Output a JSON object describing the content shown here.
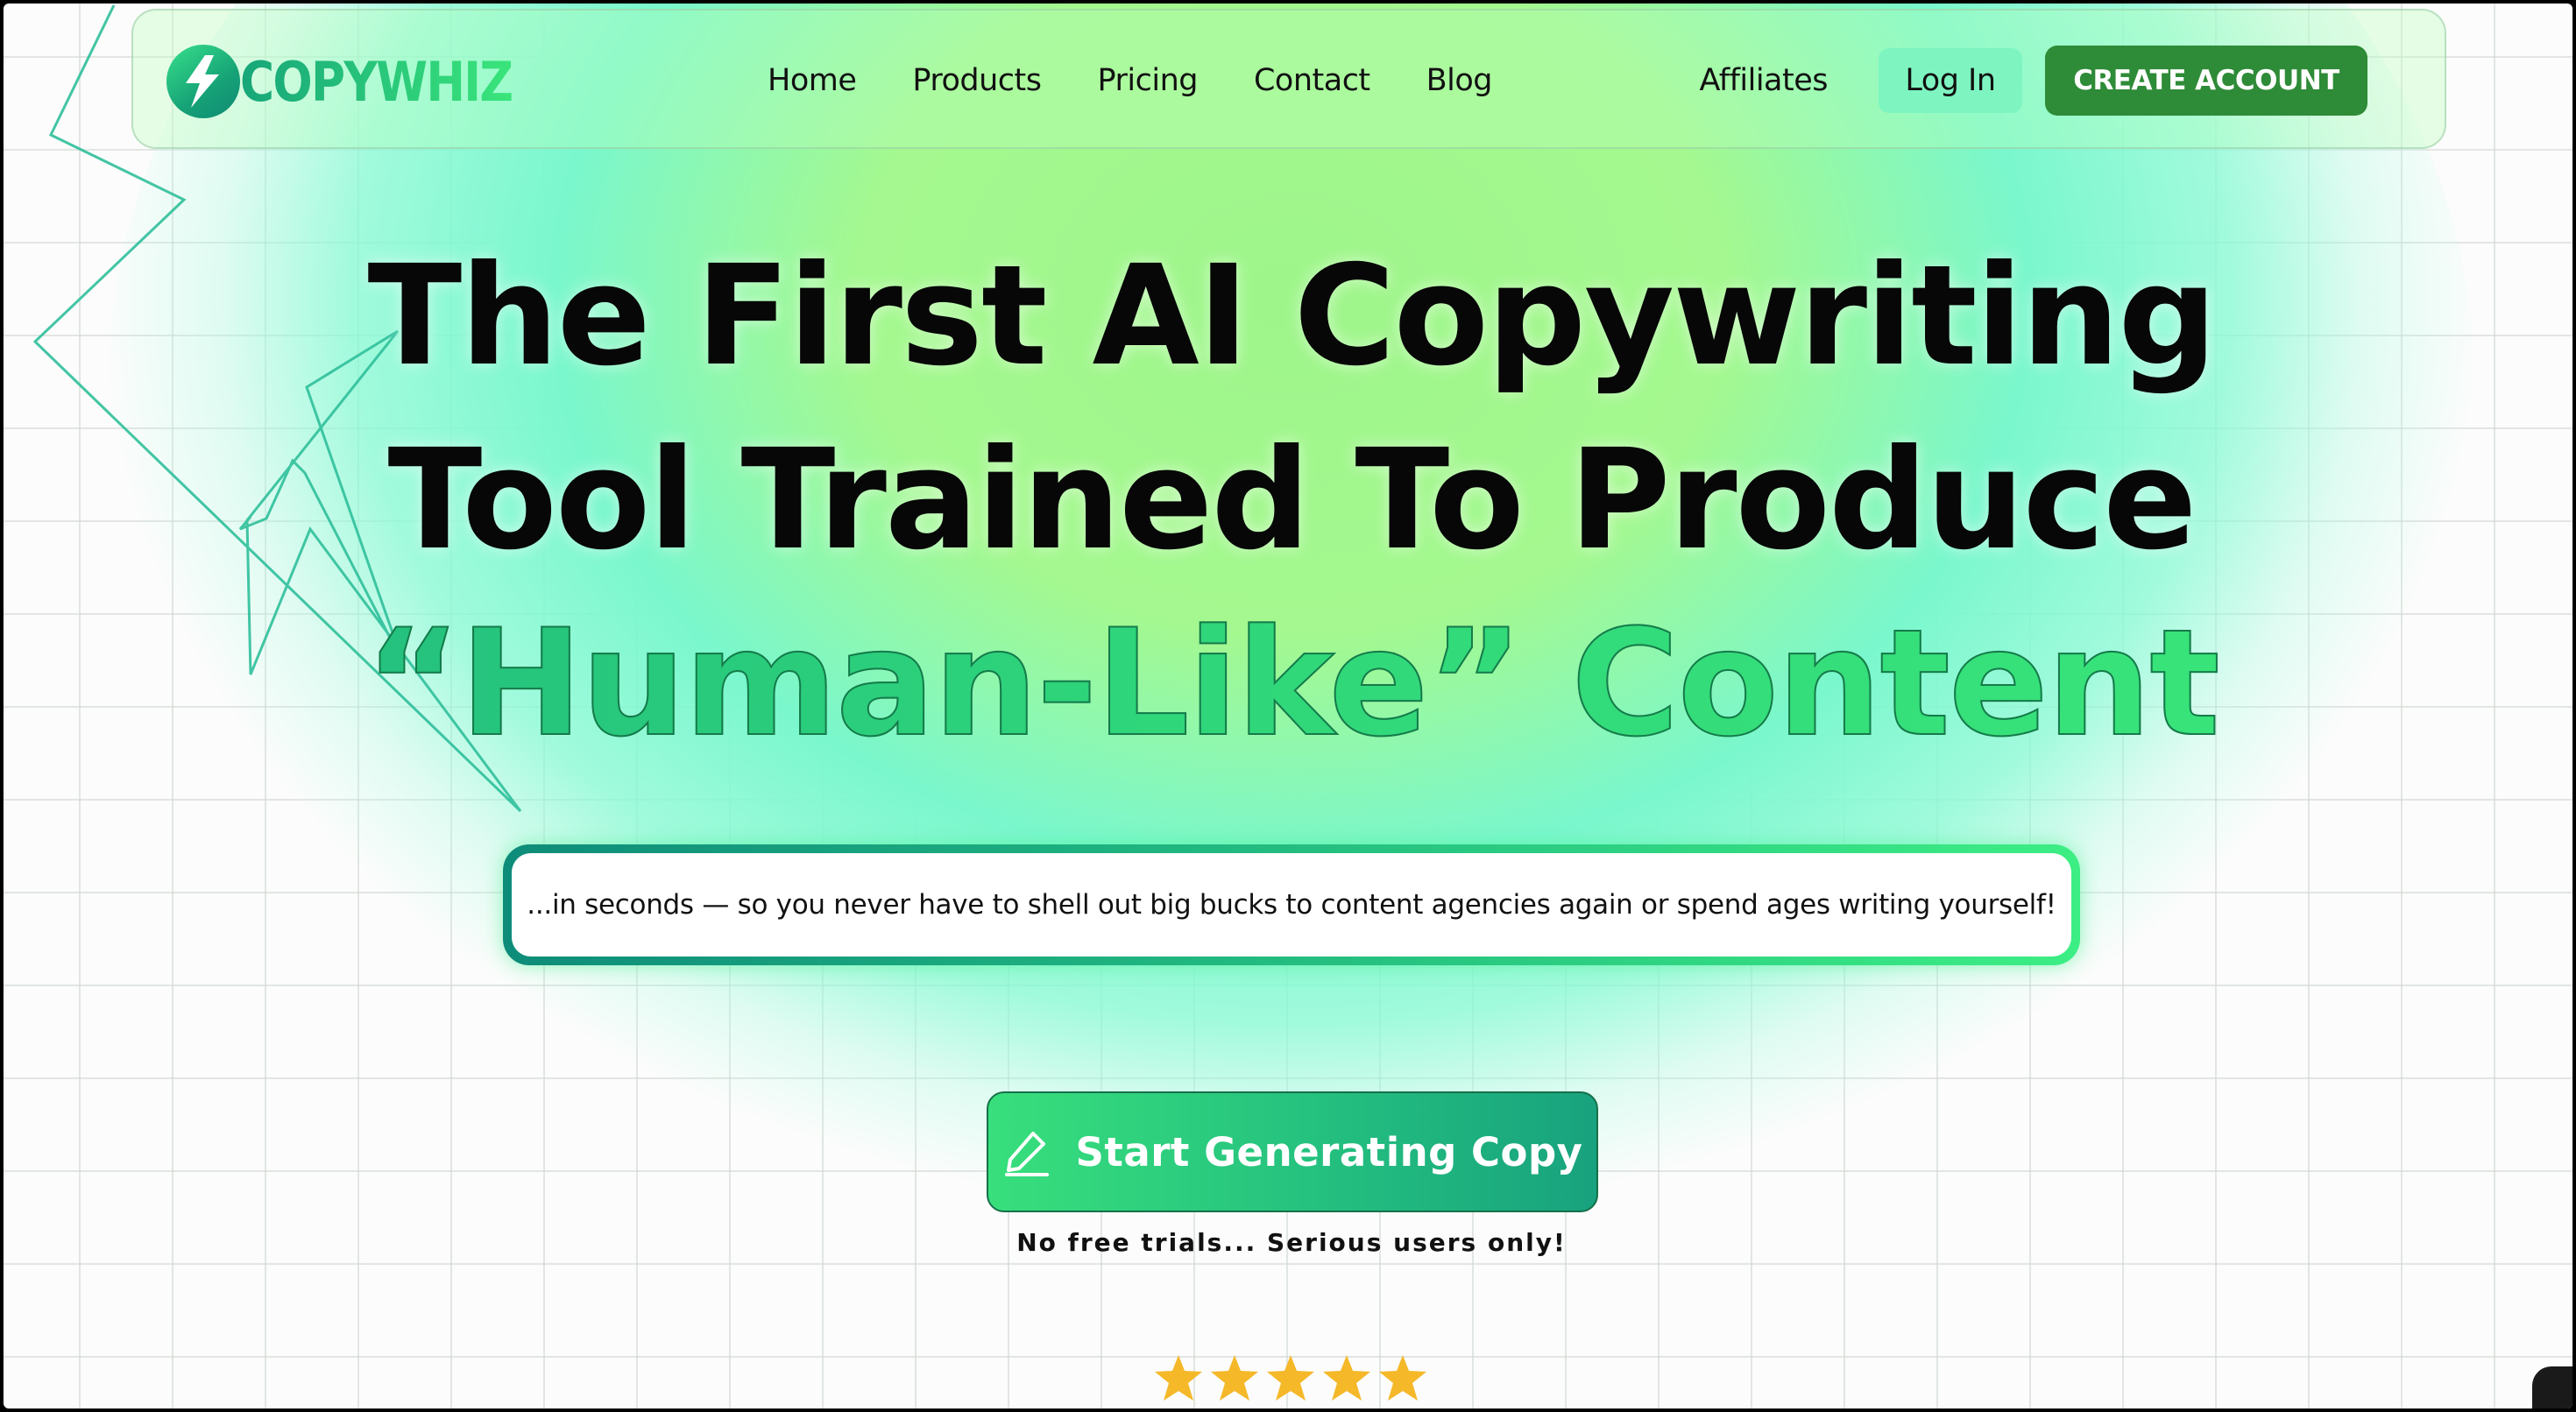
{
  "brand": {
    "name": "COPYWHIZ",
    "icon": "lightning-bolt-icon",
    "color_start": "#17a679",
    "color_end": "#3ae57b"
  },
  "nav": {
    "links": [
      "Home",
      "Products",
      "Pricing",
      "Contact",
      "Blog"
    ],
    "affiliates": "Affiliates",
    "login": "Log In",
    "create_account": "CREATE ACCOUNT"
  },
  "hero": {
    "headline_line1": "The First AI Copywriting",
    "headline_line2": "Tool Trained To Produce",
    "highlight": "“Human-Like” Content",
    "subtext": "...in seconds — so you never have to shell out big bucks to content agencies again or spend ages writing yourself!",
    "cta_label": "Start Generating Copy",
    "cta_icon": "pencil-icon",
    "cta_note": "No free trials... Serious users only!"
  },
  "rating": {
    "stars": 5,
    "icon": "star-icon",
    "star_color": "#f5b829"
  },
  "colors": {
    "accent_green": "#2e8b37",
    "highlight_green": "#2fd67a",
    "login_bg": "#7ef5c1"
  }
}
